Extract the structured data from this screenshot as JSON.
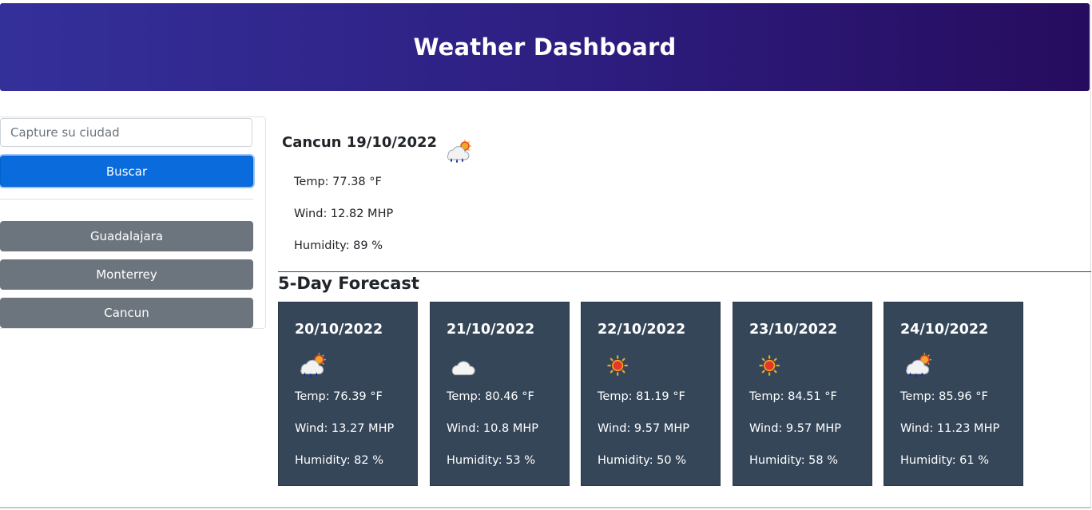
{
  "header": {
    "title": "Weather Dashboard"
  },
  "search": {
    "placeholder": "Capture su ciudad",
    "value": "",
    "button_label": "Buscar"
  },
  "history": [
    "Guadalajara",
    "Monterrey",
    "Cancun"
  ],
  "current": {
    "title": "Cancun 19/10/2022",
    "icon": "rain-sun-icon",
    "temp": "Temp: 77.38 °F",
    "wind": "Wind: 12.82 MHP",
    "humidity": "Humidity: 89 %"
  },
  "forecast_title": "5-Day Forecast",
  "forecast": [
    {
      "date": "20/10/2022",
      "icon": "rain-sun-icon",
      "temp": "Temp: 76.39 °F",
      "wind": "Wind: 13.27 MHP",
      "humidity": "Humidity: 82 %"
    },
    {
      "date": "21/10/2022",
      "icon": "cloud-icon",
      "temp": "Temp: 80.46 °F",
      "wind": "Wind: 10.8 MHP",
      "humidity": "Humidity: 53 %"
    },
    {
      "date": "22/10/2022",
      "icon": "sun-icon",
      "temp": "Temp: 81.19 °F",
      "wind": "Wind: 9.57 MHP",
      "humidity": "Humidity: 50 %"
    },
    {
      "date": "23/10/2022",
      "icon": "sun-icon",
      "temp": "Temp: 84.51 °F",
      "wind": "Wind: 9.57 MHP",
      "humidity": "Humidity: 58 %"
    },
    {
      "date": "24/10/2022",
      "icon": "rain-sun-icon",
      "temp": "Temp: 85.96 °F",
      "wind": "Wind: 11.23 MHP",
      "humidity": "Humidity: 61 %"
    }
  ],
  "colors": {
    "header_start": "#34309a",
    "header_end": "#260c5e",
    "primary": "#0a6cdc",
    "secondary": "#6c757d",
    "card": "#354659"
  }
}
